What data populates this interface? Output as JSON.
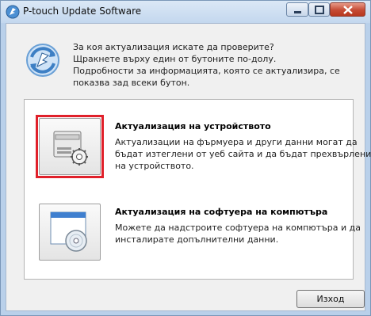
{
  "window": {
    "title": "P-touch Update Software",
    "controls": [
      "minimize",
      "maximize",
      "close"
    ]
  },
  "intro": {
    "lines": [
      "За коя актуализация искате да проверите?",
      "Щракнете върху един от бутоните по-долу.",
      "Подробности за информацията, която се актуализира, се",
      "показва зад всеки бутон."
    ]
  },
  "options": {
    "device": {
      "title": "Актуализация на устройството",
      "desc": [
        "Актуализации на фърмуера и други данни могат да",
        "бъдат изтеглени от уеб сайта и да бъдат прехвърлени",
        "на устройството."
      ],
      "icon": "printer-gear-icon",
      "selected": true
    },
    "software": {
      "title": "Актуализация на софтуера на компютъра",
      "desc": [
        "Можете да надстроите софтуера на компютъра и да",
        "инсталирате допълнителни данни."
      ],
      "icon": "window-disc-icon"
    }
  },
  "footer": {
    "exit_label": "Изход"
  },
  "colors": {
    "highlight": "#e0202a",
    "title_bar": "#c3d7ee",
    "close_button": "#c54a34"
  }
}
